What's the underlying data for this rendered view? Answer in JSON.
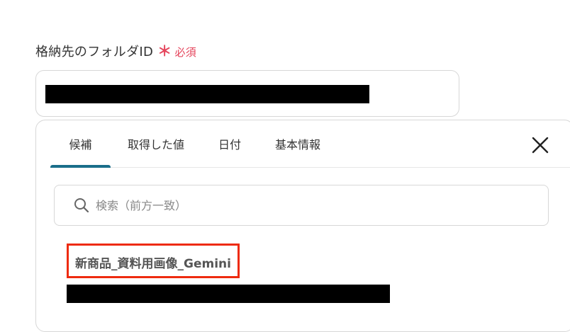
{
  "field": {
    "label": "格納先のフォルダID",
    "required_mark": "＊",
    "required_text": "必須"
  },
  "tabs": [
    {
      "label": "候補",
      "active": true
    },
    {
      "label": "取得した値",
      "active": false
    },
    {
      "label": "日付",
      "active": false
    },
    {
      "label": "基本情報",
      "active": false
    }
  ],
  "search": {
    "placeholder": "検索（前方一致）"
  },
  "candidates": [
    {
      "name": "新商品_資料用画像_Gemini"
    }
  ],
  "colors": {
    "accent": "#1a6e8a",
    "required": "#e5455c",
    "highlight_border": "#ee2b0f"
  },
  "icons": {
    "close": "close-icon",
    "search": "search-icon"
  }
}
